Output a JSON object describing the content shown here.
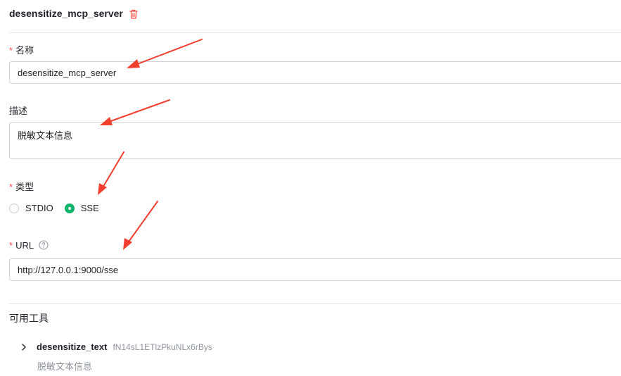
{
  "header": {
    "title": "desensitize_mcp_server"
  },
  "form": {
    "name": {
      "required_mark": "*",
      "label": "名称",
      "value": "desensitize_mcp_server"
    },
    "description": {
      "label": "描述",
      "value": "脱敏文本信息"
    },
    "type": {
      "required_mark": "*",
      "label": "类型",
      "options": [
        "STDIO",
        "SSE"
      ],
      "selected": "SSE"
    },
    "url": {
      "required_mark": "*",
      "label": "URL",
      "value": "http://127.0.0.1:9000/sse"
    }
  },
  "tools": {
    "section_title": "可用工具",
    "items": [
      {
        "name": "desensitize_text",
        "id": "fN14sL1ETlzPkuNLx6rBys",
        "description": "脱敏文本信息"
      }
    ]
  },
  "colors": {
    "accent": "#0fb46a",
    "danger": "#f54a45",
    "annotation_arrow": "#f03e2f"
  }
}
